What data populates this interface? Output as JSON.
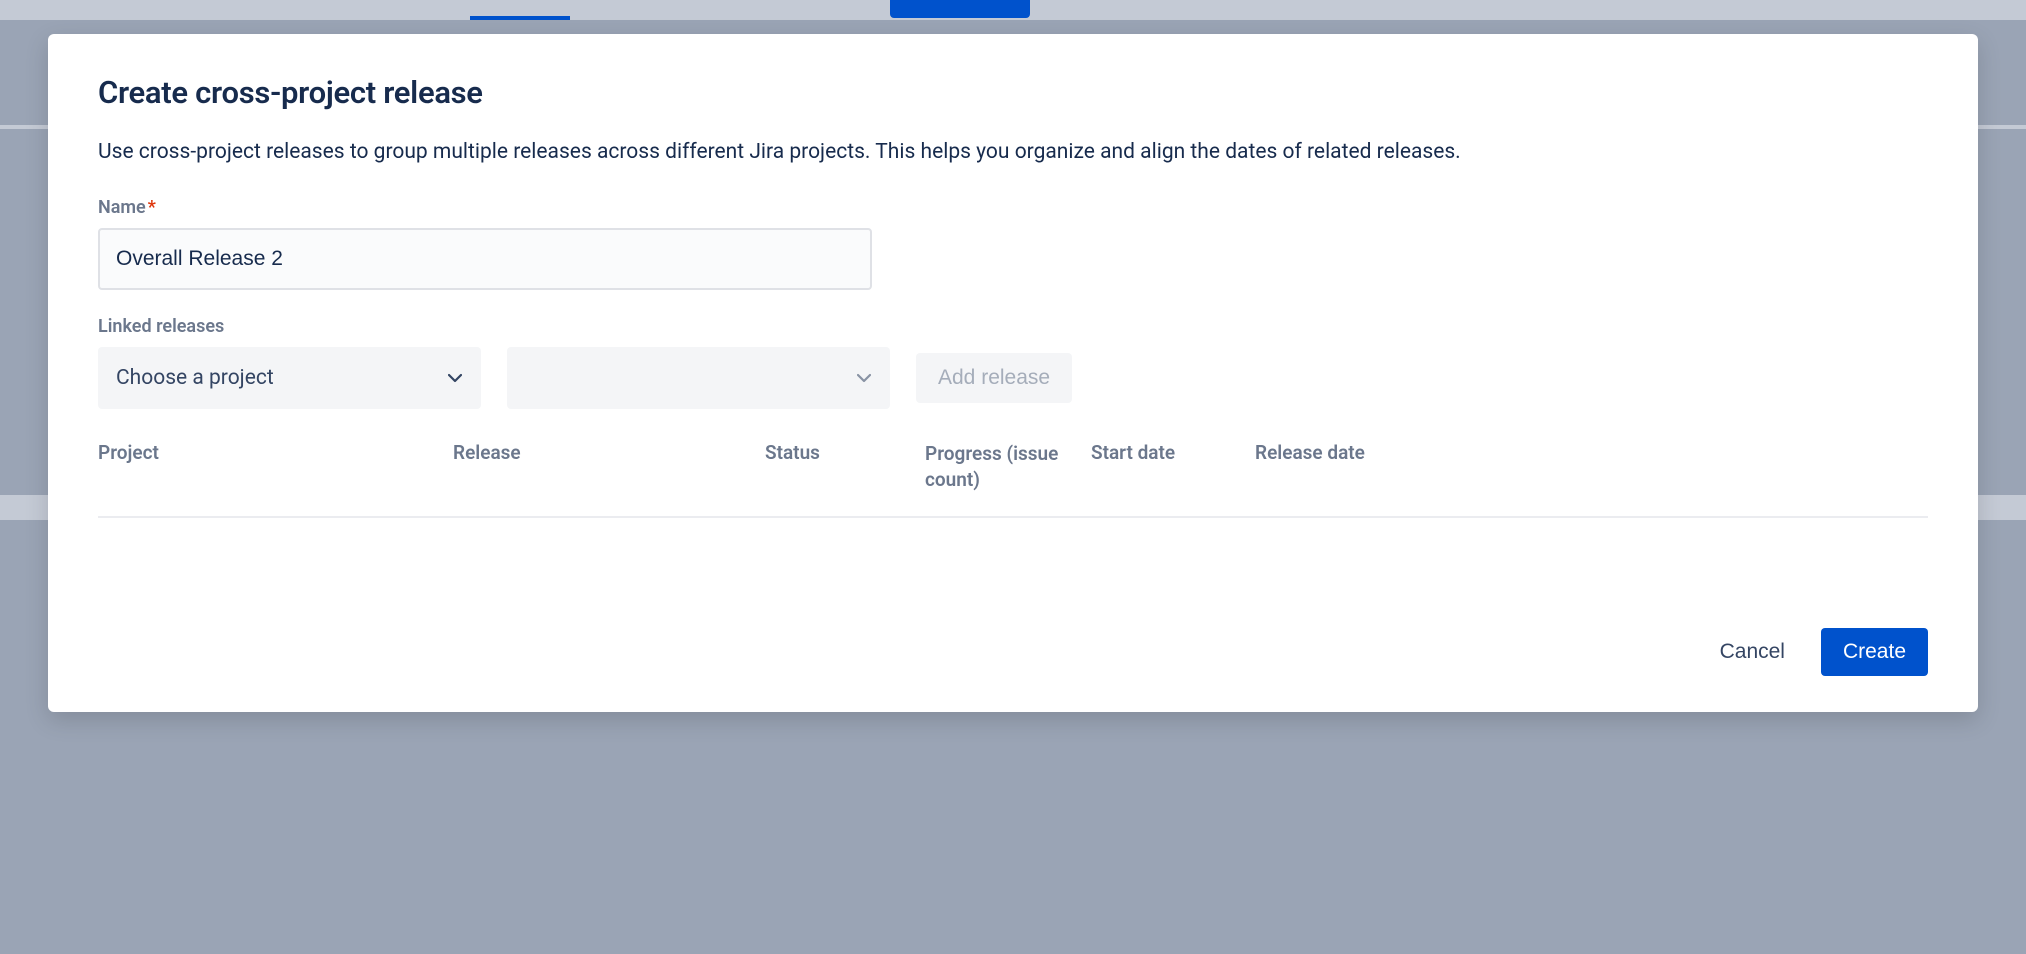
{
  "modal": {
    "title": "Create cross-project release",
    "description": "Use cross-project releases to group multiple releases across different Jira projects. This helps you organize and align the dates of related releases.",
    "name_label": "Name",
    "name_value": "Overall Release 2",
    "linked_releases_label": "Linked releases",
    "project_select_placeholder": "Choose a project",
    "release_select_placeholder": "",
    "add_release_label": "Add release",
    "table_headers": {
      "project": "Project",
      "release": "Release",
      "status": "Status",
      "progress": "Progress (issue count)",
      "start_date": "Start date",
      "release_date": "Release date"
    },
    "footer": {
      "cancel": "Cancel",
      "create": "Create"
    }
  }
}
